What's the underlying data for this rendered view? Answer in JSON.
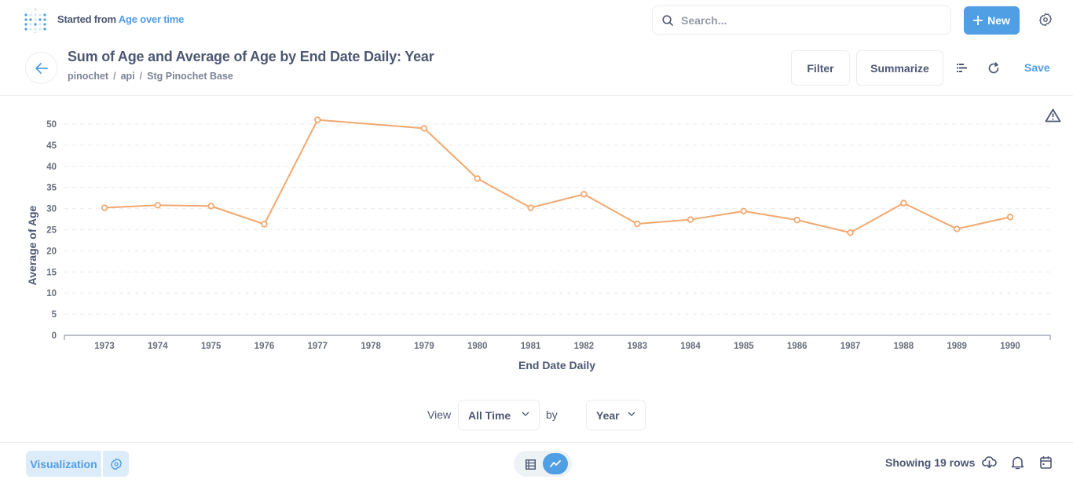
{
  "topbar": {
    "logo_icon": "metabase-logo-icon",
    "started_prefix": "Started from",
    "started_link": "Age over time",
    "search_placeholder": "Search...",
    "new_label": "New",
    "settings_icon": "gear-icon"
  },
  "header": {
    "title": "Sum of Age and Average of Age by End Date Daily: Year",
    "breadcrumbs": [
      "pinochet",
      "api",
      "Stg Pinochet Base"
    ],
    "filter_label": "Filter",
    "summarize_label": "Summarize",
    "save_label": "Save"
  },
  "colors": {
    "accent": "#509ee3",
    "series": "#f2a86f",
    "text": "#4c5773"
  },
  "chart_data": {
    "type": "line",
    "title": "",
    "xlabel": "End Date Daily",
    "ylabel": "Average of Age",
    "ylim": [
      0,
      50
    ],
    "yticks": [
      0,
      5,
      10,
      15,
      20,
      25,
      30,
      35,
      40,
      45,
      50
    ],
    "categories": [
      "1973",
      "1974",
      "1975",
      "1976",
      "1977",
      "1978",
      "1979",
      "1980",
      "1981",
      "1982",
      "1983",
      "1984",
      "1985",
      "1986",
      "1987",
      "1988",
      "1989",
      "1990"
    ],
    "series": [
      {
        "name": "Average of Age",
        "color": "#f2a86f",
        "values": [
          30.2,
          30.8,
          30.6,
          26.3,
          51.0,
          null,
          49.0,
          37.1,
          30.2,
          33.4,
          26.4,
          27.4,
          29.4,
          27.3,
          24.3,
          31.3,
          25.2,
          28.0
        ]
      }
    ],
    "grid": true,
    "legend": "none"
  },
  "viewbar": {
    "view_label": "View",
    "range_value": "All Time",
    "by_label": "by",
    "unit_value": "Year"
  },
  "footer": {
    "visualization_label": "Visualization",
    "rows_text": "Showing 19 rows"
  }
}
